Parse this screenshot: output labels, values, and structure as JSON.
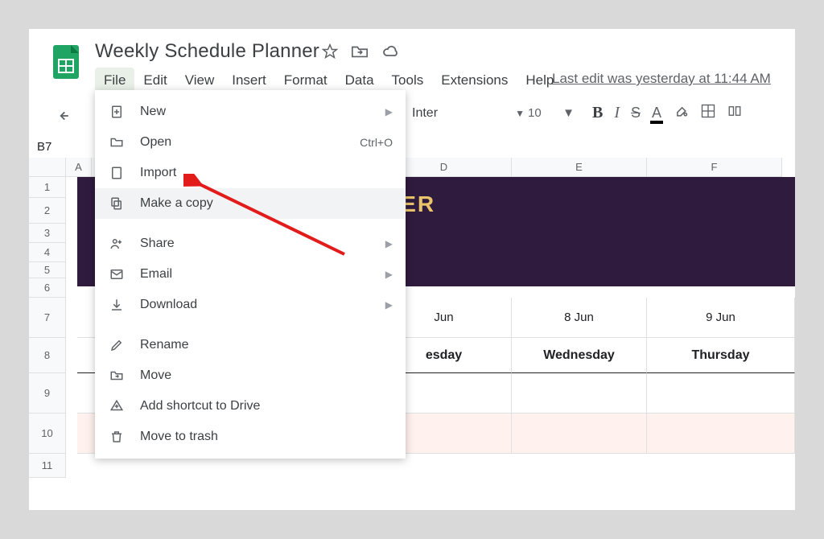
{
  "doc": {
    "title": "Weekly Schedule Planner",
    "edit_status": "Last edit was yesterday at 11:44 AM"
  },
  "menubar": {
    "file": "File",
    "edit": "Edit",
    "view": "View",
    "insert": "Insert",
    "format": "Format",
    "data": "Data",
    "tools": "Tools",
    "extensions": "Extensions",
    "help": "Help"
  },
  "toolbar": {
    "font_name": "Inter",
    "font_size": "10"
  },
  "namebox": {
    "value": "B7"
  },
  "file_menu": {
    "new": "New",
    "open": "Open",
    "open_shortcut": "Ctrl+O",
    "import": "Import",
    "make_copy": "Make a copy",
    "share": "Share",
    "email": "Email",
    "download": "Download",
    "rename": "Rename",
    "move": "Move",
    "add_shortcut": "Add shortcut to Drive",
    "move_trash": "Move to trash"
  },
  "grid": {
    "columns": [
      "A",
      "D",
      "E",
      "F"
    ],
    "rows": [
      "1",
      "2",
      "3",
      "4",
      "5",
      "6",
      "7",
      "8",
      "9",
      "10",
      "11"
    ],
    "banner_title_visible": "NER",
    "dates": {
      "d": "Jun",
      "e": "8 Jun",
      "f": "9 Jun"
    },
    "days": {
      "d": "esday",
      "e": "Wednesday",
      "f": "Thursday"
    }
  }
}
